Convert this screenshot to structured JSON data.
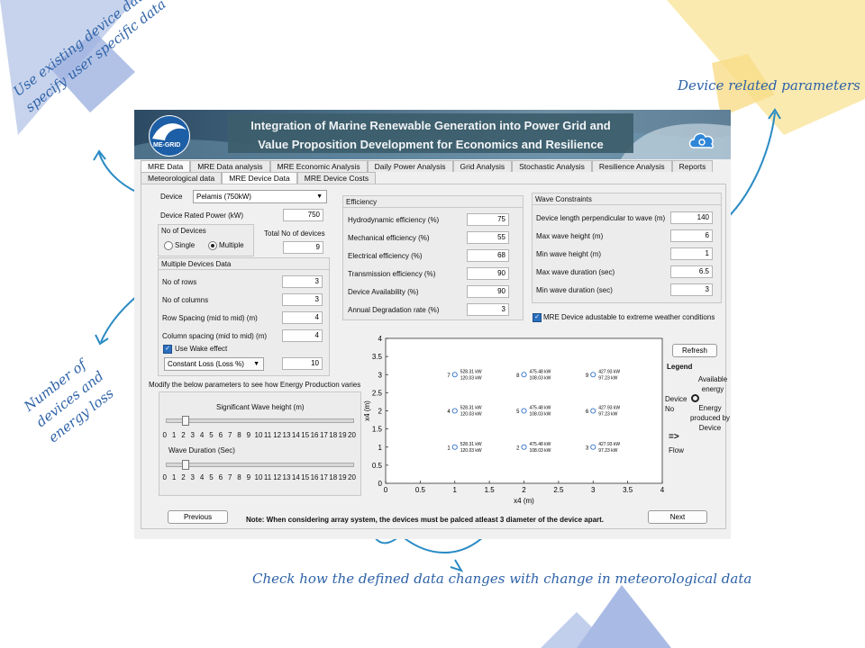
{
  "annotations": {
    "top_left": "Use existing device data or specify user specific data",
    "top_right": "Device related parameters",
    "left_mid": "Number of devices and energy loss",
    "bottom": "Check how the defined data changes with change in meteorological data"
  },
  "header": {
    "logo_text": "ME-GRID",
    "title_line1": "Integration of Marine Renewable Generation into Power Grid and",
    "title_line2": "Value Proposition Development for Economics and Resilience"
  },
  "tabs_row1": [
    "MRE Data",
    "MRE Data analysis",
    "MRE Economic Analysis",
    "Daily Power Analysis",
    "Grid Analysis",
    "Stochastic Analysis",
    "Resilience Analysis",
    "Reports"
  ],
  "tabs_row2": [
    "Meteorological data",
    "MRE Device Data",
    "MRE Device Costs"
  ],
  "device": {
    "label": "Device",
    "selected": "Pelamis (750kW)",
    "rated_power_label": "Device Rated Power (kW)",
    "rated_power": "750",
    "no_of_devices_label": "No of Devices",
    "single_label": "Single",
    "multiple_label": "Multiple",
    "total_label": "Total No of devices",
    "total": "9"
  },
  "multiple": {
    "title": "Multiple Devices Data",
    "rows_label": "No of rows",
    "rows": "3",
    "cols_label": "No of columns",
    "cols": "3",
    "row_spacing_label": "Row Spacing (mid to mid) (m)",
    "row_spacing": "4",
    "col_spacing_label": "Column spacing (mid to mid) (m)",
    "col_spacing": "4",
    "wake_label": "Use Wake effect",
    "loss_type": "Constant Loss (Loss %)",
    "loss_value": "10"
  },
  "efficiency": {
    "title": "Efficiency",
    "items": [
      {
        "label": "Hydrodynamic efficiency (%)",
        "value": "75"
      },
      {
        "label": "Mechanical efficiency (%)",
        "value": "55"
      },
      {
        "label": "Electrical efficiency (%)",
        "value": "68"
      },
      {
        "label": "Transmission efficiency (%)",
        "value": "90"
      },
      {
        "label": "Device Availability (%)",
        "value": "90"
      },
      {
        "label": "Annual Degradation rate (%)",
        "value": "3"
      }
    ]
  },
  "constraints": {
    "title": "Wave Constraints",
    "items": [
      {
        "label": "Device length perpendicular to wave (m)",
        "value": "140"
      },
      {
        "label": "Max wave height (m)",
        "value": "6"
      },
      {
        "label": "Min wave height (m)",
        "value": "1"
      },
      {
        "label": "Max wave duration (sec)",
        "value": "6.5"
      },
      {
        "label": "Min wave duration (sec)",
        "value": "3"
      }
    ],
    "extreme_label": "MRE Device adustable to extreme weather conditions"
  },
  "sliders": {
    "intro": "Modify the below parameters to see how Energy Production varies",
    "wave_height_label": "Significant Wave height (m)",
    "wave_height_value": 2,
    "wave_duration_label": "Wave Duration (Sec)",
    "wave_duration_value": 2,
    "ticks": [
      "0",
      "1",
      "2",
      "3",
      "4",
      "5",
      "6",
      "7",
      "8",
      "9",
      "10",
      "11",
      "12",
      "13",
      "14",
      "15",
      "16",
      "17",
      "18",
      "19",
      "20"
    ]
  },
  "legend": {
    "refresh": "Refresh",
    "title": "Legend",
    "available": "Available energy",
    "device_no": "Device No",
    "produced": "Energy produced by Device",
    "flow_symbol": "=>",
    "flow": "Flow"
  },
  "buttons": {
    "previous": "Previous",
    "next": "Next"
  },
  "note": "Note: When considering array system, the devices must be palced atleast 3 diameter of the device apart.",
  "chart_data": {
    "type": "scatter",
    "xlabel": "x4 (m)",
    "ylabel": "x4 (m)",
    "xlim": [
      0,
      4
    ],
    "ylim": [
      0,
      4
    ],
    "xticks": [
      "0",
      "0.5",
      "1",
      "1.5",
      "2",
      "2.5",
      "3",
      "3.5",
      "4"
    ],
    "yticks": [
      "0",
      "0.5",
      "1",
      "1.5",
      "2",
      "2.5",
      "3",
      "3.5",
      "4"
    ],
    "points": [
      {
        "id": "1",
        "x": 1,
        "y": 1,
        "available": "528.31 kW",
        "produced": "120.03 kW"
      },
      {
        "id": "2",
        "x": 2,
        "y": 1,
        "available": "475.48 kW",
        "produced": "108.03 kW"
      },
      {
        "id": "3",
        "x": 3,
        "y": 1,
        "available": "427.93 kW",
        "produced": "97.23 kW"
      },
      {
        "id": "4",
        "x": 1,
        "y": 2,
        "available": "528.31 kW",
        "produced": "120.03 kW"
      },
      {
        "id": "5",
        "x": 2,
        "y": 2,
        "available": "475.48 kW",
        "produced": "108.03 kW"
      },
      {
        "id": "6",
        "x": 3,
        "y": 2,
        "available": "427.93 kW",
        "produced": "97.23 kW"
      },
      {
        "id": "7",
        "x": 1,
        "y": 3,
        "available": "528.31 kW",
        "produced": "120.03 kW"
      },
      {
        "id": "8",
        "x": 2,
        "y": 3,
        "available": "475.48 kW",
        "produced": "108.03 kW"
      },
      {
        "id": "9",
        "x": 3,
        "y": 3,
        "available": "427.93 kW",
        "produced": "97.23 kW"
      }
    ],
    "colors": {
      "marker": "#2f6fc6"
    }
  }
}
